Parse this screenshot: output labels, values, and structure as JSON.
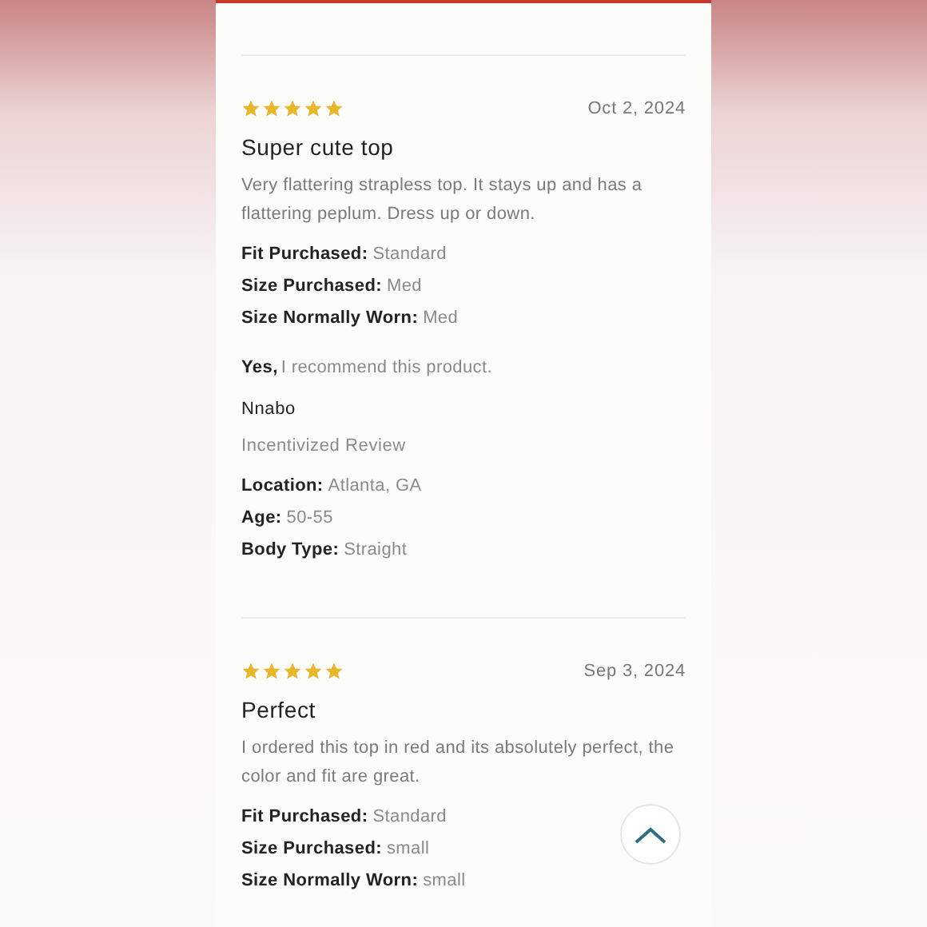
{
  "reviews": [
    {
      "stars": 5,
      "date": "Oct 2, 2024",
      "title": "Super cute top",
      "body": "Very flattering strapless top. It stays up and has a flattering peplum. Dress up or down.",
      "fit": [
        {
          "label": "Fit Purchased:",
          "value": "Standard"
        },
        {
          "label": "Size Purchased:",
          "value": "Med"
        },
        {
          "label": "Size Normally Worn:",
          "value": "Med"
        }
      ],
      "recommend": {
        "answer": "Yes,",
        "text": "I recommend this product."
      },
      "reviewer": "Nnabo",
      "badge": "Incentivized Review",
      "details": [
        {
          "label": "Location:",
          "value": "Atlanta, GA"
        },
        {
          "label": "Age:",
          "value": "50-55"
        },
        {
          "label": "Body Type:",
          "value": "Straight"
        }
      ]
    },
    {
      "stars": 5,
      "date": "Sep 3, 2024",
      "title": "Perfect",
      "body": "I ordered this top in red and its absolutely perfect, the color and fit are great.",
      "fit": [
        {
          "label": "Fit Purchased:",
          "value": "Standard"
        },
        {
          "label": "Size Purchased:",
          "value": "small"
        },
        {
          "label": "Size Normally Worn:",
          "value": "small"
        }
      ]
    }
  ]
}
